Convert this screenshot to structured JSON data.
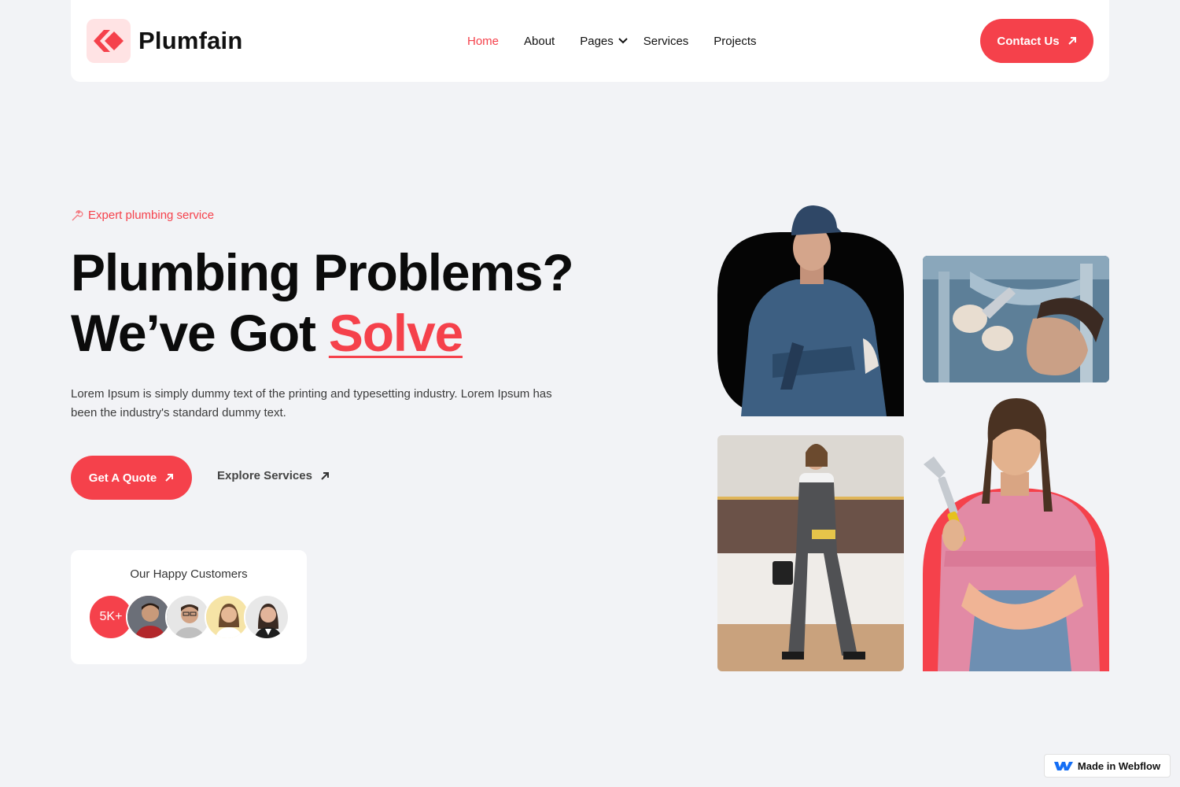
{
  "brand": {
    "name": "Plumfain",
    "accent": "#f5414b"
  },
  "nav": {
    "items": [
      {
        "label": "Home",
        "active": true
      },
      {
        "label": "About"
      },
      {
        "label": "Pages",
        "dropdown": true
      },
      {
        "label": "Services"
      },
      {
        "label": "Projects"
      }
    ],
    "cta": "Contact Us"
  },
  "hero": {
    "tag": "Expert plumbing service",
    "headline_line1": "Plumbing Problems?",
    "headline_line2": "We’ve Got ",
    "headline_accent": "Solve",
    "lead": "Lorem Ipsum is simply dummy text of the printing and typesetting industry. Lorem Ipsum has been the industry's standard dummy text.",
    "primary_button": "Get A Quote",
    "secondary_link": "Explore Services"
  },
  "customers": {
    "title": "Our Happy Customers",
    "count": "5K+"
  },
  "badge": {
    "label": "Made in Webflow"
  }
}
